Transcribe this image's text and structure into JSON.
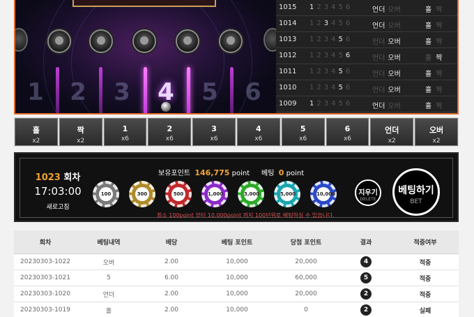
{
  "board": {
    "slots": [
      "1",
      "2",
      "3",
      "4",
      "5",
      "6"
    ],
    "highlight": "4"
  },
  "history": [
    {
      "round": "1015",
      "digits": [
        "1",
        "2",
        "3",
        "4",
        "5",
        "6"
      ],
      "result": "1",
      "under": "언더",
      "over": "오버",
      "odd": "홀",
      "even": "짝",
      "uo": "under",
      "oe": "odd"
    },
    {
      "round": "1014",
      "digits": [
        "1",
        "2",
        "3",
        "4",
        "5",
        "6"
      ],
      "result": "3",
      "under": "언더",
      "over": "오버",
      "odd": "홀",
      "even": "짝",
      "uo": "under",
      "oe": "odd"
    },
    {
      "round": "1013",
      "digits": [
        "1",
        "2",
        "3",
        "4",
        "5",
        "6"
      ],
      "result": "5",
      "under": "언더",
      "over": "오버",
      "odd": "홀",
      "even": "짝",
      "uo": "over",
      "oe": "odd"
    },
    {
      "round": "1012",
      "digits": [
        "1",
        "2",
        "3",
        "4",
        "5",
        "6"
      ],
      "result": "6",
      "under": "언더",
      "over": "오버",
      "odd": "홀",
      "even": "짝",
      "uo": "over",
      "oe": "even"
    },
    {
      "round": "1011",
      "digits": [
        "1",
        "2",
        "3",
        "4",
        "5",
        "6"
      ],
      "result": "5",
      "under": "언더",
      "over": "오버",
      "odd": "홀",
      "even": "짝",
      "uo": "over",
      "oe": "odd"
    },
    {
      "round": "1010",
      "digits": [
        "1",
        "2",
        "3",
        "4",
        "5",
        "6"
      ],
      "result": "5",
      "under": "언더",
      "over": "오버",
      "odd": "홀",
      "even": "짝",
      "uo": "over",
      "oe": "odd"
    },
    {
      "round": "1009",
      "digits": [
        "1",
        "2",
        "3",
        "4",
        "5",
        "6"
      ],
      "result": "1",
      "under": "언더",
      "over": "오버",
      "odd": "홀",
      "even": "짝",
      "uo": "under",
      "oe": "odd"
    }
  ],
  "options": [
    {
      "label": "홀",
      "odds": "x2"
    },
    {
      "label": "짝",
      "odds": "x2"
    },
    {
      "label": "1",
      "odds": "x6"
    },
    {
      "label": "2",
      "odds": "x6"
    },
    {
      "label": "3",
      "odds": "x6"
    },
    {
      "label": "4",
      "odds": "x6"
    },
    {
      "label": "5",
      "odds": "x6"
    },
    {
      "label": "6",
      "odds": "x6"
    },
    {
      "label": "언더",
      "odds": "x2"
    },
    {
      "label": "오버",
      "odds": "x2"
    }
  ],
  "panel": {
    "round_number": "1023",
    "round_suffix": "회차",
    "clock": "17:03:00",
    "refresh_label": "새로고침",
    "points_label": "보유포인트",
    "points_value": "146,775",
    "points_unit": "point",
    "bet_label": "베팅",
    "bet_value": "0",
    "bet_unit": "point",
    "chips": [
      {
        "value": "100",
        "color": "#7a7a7a"
      },
      {
        "value": "300",
        "color": "#b08a2a"
      },
      {
        "value": "500",
        "color": "#c0282c"
      },
      {
        "value": "1,000",
        "color": "#8a2ac8"
      },
      {
        "value": "3,000",
        "color": "#2ea828"
      },
      {
        "value": "5,000",
        "color": "#1aa5b0"
      },
      {
        "value": "10,000",
        "color": "#2a4ac8"
      }
    ],
    "notice": "최소 100point 부터 10,000point 까지 100단위로 베팅하실 수 있습니다.",
    "delete_ko": "지우기",
    "delete_en": "DELETE",
    "bet_ko": "베팅하기",
    "bet_en": "BET"
  },
  "table": {
    "headers": [
      "회차",
      "베팅내역",
      "배당",
      "베팅 포인트",
      "당첨 포인트",
      "결과",
      "적중여부"
    ],
    "rows": [
      [
        "20230303-1022",
        "오버",
        "2.00",
        "10,000",
        "20,000",
        "4",
        "적중"
      ],
      [
        "20230303-1021",
        "5",
        "6.00",
        "10,000",
        "60,000",
        "5",
        "적중"
      ],
      [
        "20230303-1020",
        "언더",
        "2.00",
        "10,000",
        "20,000",
        "2",
        "적중"
      ],
      [
        "20230303-1019",
        "홀",
        "2.00",
        "10,000",
        "0",
        "2",
        "실패"
      ]
    ]
  }
}
